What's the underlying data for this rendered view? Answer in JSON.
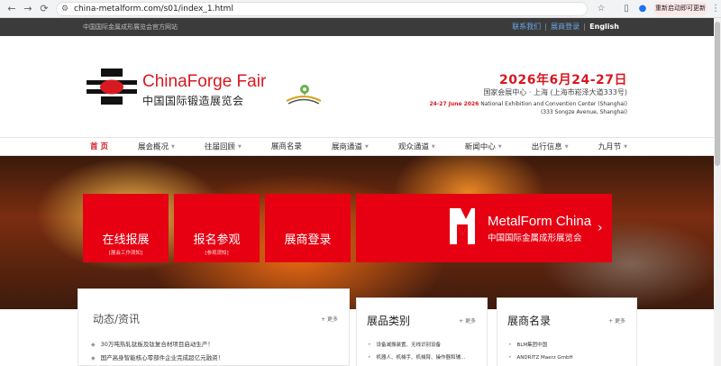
{
  "browser": {
    "url": "china-metalform.com/s01/index_1.html",
    "update_label": "重新启动即可更新",
    "back_icon": "back-arrow-icon",
    "forward_icon": "forward-arrow-icon",
    "reload_icon": "reload-icon"
  },
  "topbar": {
    "site_name": "中国国际金属成形展览会官方网站",
    "links": [
      {
        "label": "联系我们"
      },
      {
        "label": "展商登录"
      },
      {
        "label": "English"
      }
    ]
  },
  "header": {
    "logo_en": "ChinaForge Fair",
    "logo_cn": "中国国际锻造展览会",
    "date": "2026年6月24-27日",
    "venue_cn": "国家会展中心 · 上海 (上海市崧泽大道333号)",
    "venue_en_date": "24-27 June 2026",
    "venue_en": " National Exhibition and Convention Center (Shanghai)",
    "venue_addr": "(333 Songze Avenue, Shanghai)"
  },
  "nav": {
    "items": [
      {
        "label": "首 页",
        "dropdown": false
      },
      {
        "label": "展会概况",
        "dropdown": true
      },
      {
        "label": "往届回顾",
        "dropdown": true
      },
      {
        "label": "展商名录",
        "dropdown": false
      },
      {
        "label": "展商通道",
        "dropdown": true
      },
      {
        "label": "观众通道",
        "dropdown": true
      },
      {
        "label": "新闻中心",
        "dropdown": true
      },
      {
        "label": "出行信息",
        "dropdown": true
      },
      {
        "label": "九月节",
        "dropdown": true
      }
    ]
  },
  "hero": {
    "tiles": [
      {
        "title": "在线报展",
        "sub": "[展会工作须知]"
      },
      {
        "title": "报名参观",
        "sub": "[参观须知]"
      },
      {
        "title": "展商登录",
        "sub": ""
      }
    ],
    "metalform": {
      "en": "MetalForm China",
      "cn": "中国国际金属成形展览会",
      "arrow": "›"
    }
  },
  "news": {
    "title": "动态/资讯",
    "more": "+ 更多",
    "items": [
      "30万吨热轧钛板及钛复合材项目启动生产！",
      "国产高身智能核心零部件企业完成超亿元融资！"
    ]
  },
  "categories": {
    "title": "展品类别",
    "more": "+ 更多",
    "items": [
      "设备减振装置、无线识别设备",
      "机器人、机械手、机械臂、操作器和辅..."
    ]
  },
  "exhibitors": {
    "title": "展商名录",
    "more": "+ 更多",
    "items": [
      "BLM集团中国",
      "ANDRITZ Maerz GmbH"
    ]
  }
}
